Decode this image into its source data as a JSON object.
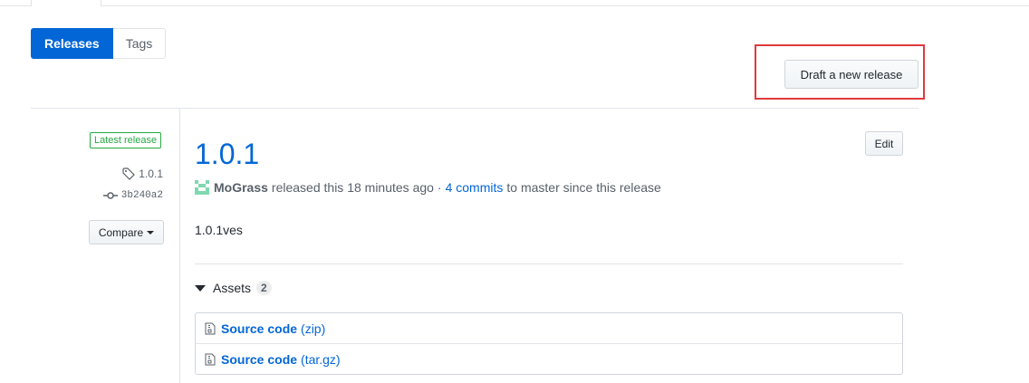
{
  "subnav": {
    "items": [
      {
        "label": "Releases",
        "selected": true
      },
      {
        "label": "Tags",
        "selected": false
      }
    ]
  },
  "actions": {
    "draft_label": "Draft a new release",
    "highlight_color": "#e0393e"
  },
  "release": {
    "badge": "Latest release",
    "tag": "1.0.1",
    "commit": "3b240a2",
    "compare_label": "Compare",
    "title": "1.0.1",
    "edit_label": "Edit",
    "author": "MoGrass",
    "released_text": "released this 18 minutes ago",
    "separator": "·",
    "commits_link": "4 commits",
    "commits_suffix": "to master since this release",
    "notes": "1.0.1ves"
  },
  "assets": {
    "label": "Assets",
    "count": "2",
    "items": [
      {
        "name": "Source code",
        "ext": "(zip)"
      },
      {
        "name": "Source code",
        "ext": "(tar.gz)"
      }
    ]
  },
  "colors": {
    "accent": "#0366d6",
    "badge_green": "#28a745"
  }
}
